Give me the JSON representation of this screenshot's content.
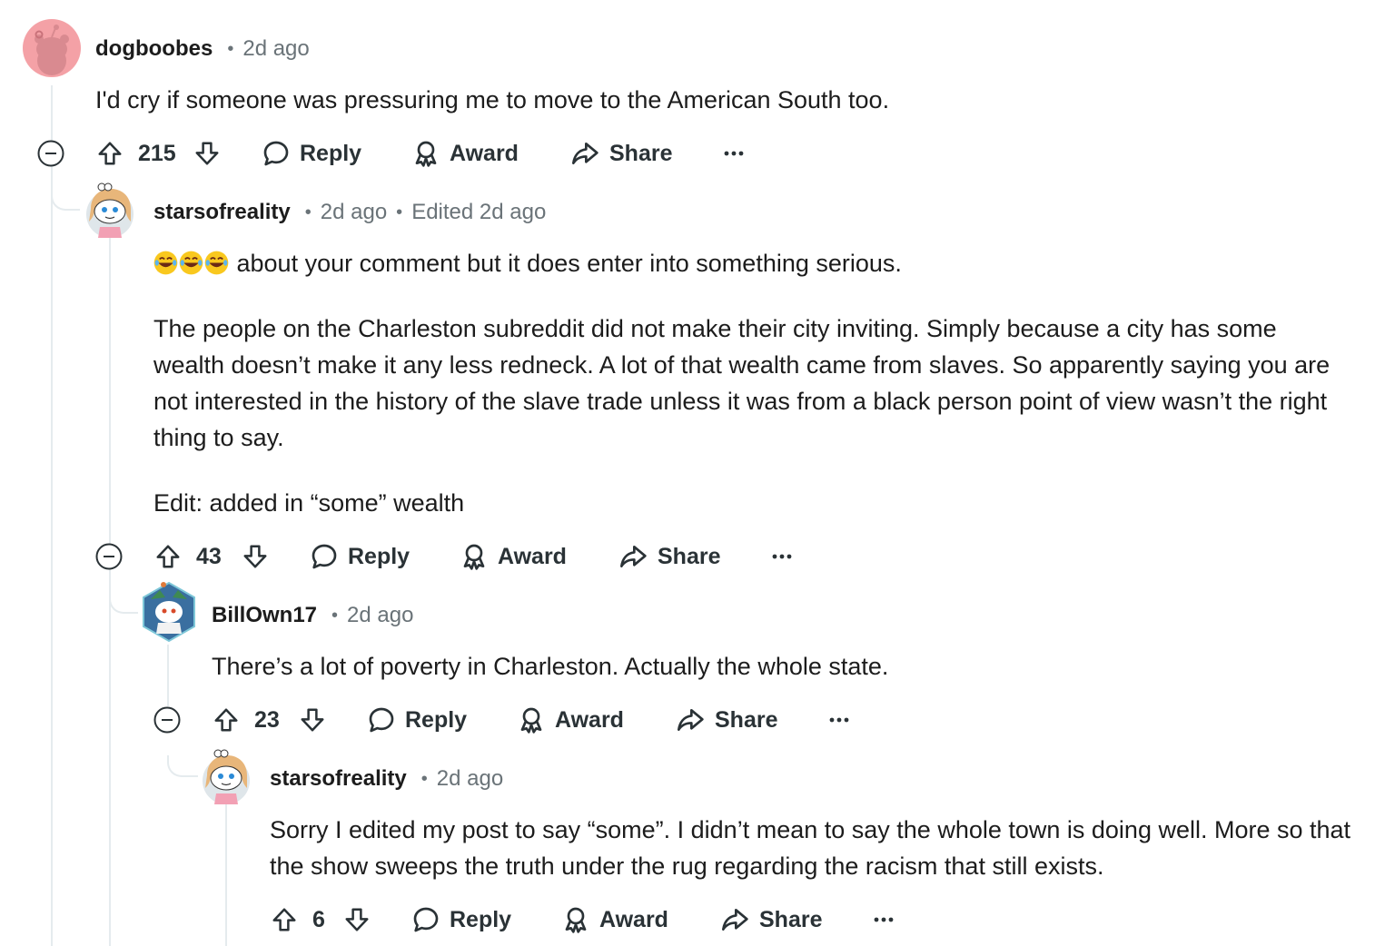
{
  "comments": [
    {
      "username": "dogboobes",
      "time": "2d ago",
      "body": "I'd cry if someone was pressuring me to move to the American South too.",
      "votes": "215",
      "actions": {
        "reply": "Reply",
        "award": "Award",
        "share": "Share"
      }
    },
    {
      "username": "starsofreality",
      "time": "2d ago",
      "edited": "Edited 2d ago",
      "emoji": "😂😂😂",
      "body_lines": [
        " about your comment but it does enter into something serious.",
        "The people on the Charleston subreddit did not make their city inviting. Simply because a city has some wealth doesn’t make it any less redneck. A lot of that wealth came from slaves. So apparently saying you are not interested in the history of the slave trade unless it was from a black person point of view wasn’t the right thing to say.",
        "Edit: added in “some” wealth"
      ],
      "votes": "43",
      "actions": {
        "reply": "Reply",
        "award": "Award",
        "share": "Share"
      }
    },
    {
      "username": "BillOwn17",
      "time": "2d ago",
      "body": "There’s a lot of poverty in Charleston. Actually the whole state.",
      "votes": "23",
      "actions": {
        "reply": "Reply",
        "award": "Award",
        "share": "Share"
      }
    },
    {
      "username": "starsofreality",
      "time": "2d ago",
      "body": "Sorry I edited my post to say “some”. I didn’t mean to say the whole town is doing well. More so that the show sweeps the truth under the rug regarding the racism that still exists.",
      "votes": "6",
      "actions": {
        "reply": "Reply",
        "award": "Award",
        "share": "Share"
      }
    }
  ],
  "colors": {
    "thread_line": "#e5ebee",
    "text": "#1c1c1c",
    "meta": "#6a7378",
    "avatar_pink": "#f4a1a6"
  }
}
